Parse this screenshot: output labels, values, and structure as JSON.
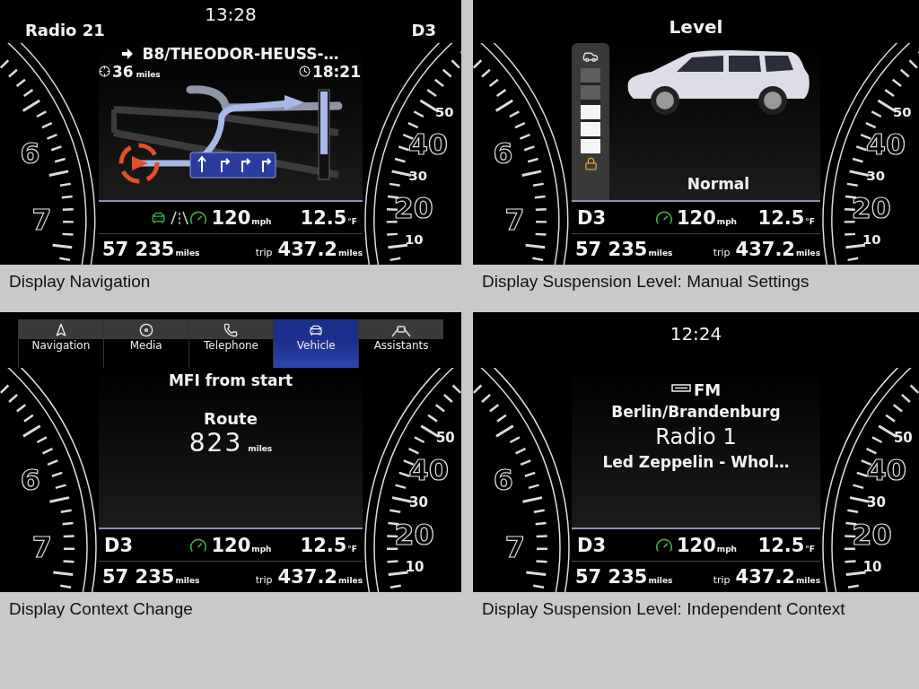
{
  "panels": [
    {
      "kind": "navigation",
      "caption": "Display Navigation",
      "header": {
        "left": "Radio 21",
        "time": "13:28",
        "right": "D3"
      },
      "route": {
        "street": "B8/THEODOR-HEUSS-…",
        "distance": "36",
        "distance_unit": "miles",
        "arrival": "18:21"
      },
      "status": {
        "lane_assist": true,
        "speed": "120",
        "speed_unit": "mph",
        "temperature": "12.5",
        "temperature_unit": "°F"
      },
      "odometer": {
        "total": "57 235",
        "total_unit": "miles",
        "trip_label": "trip",
        "trip": "437.2",
        "trip_unit": "miles"
      },
      "tach_labels": [
        "6",
        "7"
      ],
      "speed_labels": [
        "50",
        "40",
        "30",
        "20",
        "10"
      ]
    },
    {
      "kind": "suspension",
      "caption": "Display Suspension Level: Manual Settings",
      "title": "Level",
      "mode": "Normal",
      "level": 0.6,
      "status": {
        "gear": "D3",
        "speed": "120",
        "speed_unit": "mph",
        "temperature": "12.5",
        "temperature_unit": "°F"
      },
      "odometer": {
        "total": "57 235",
        "total_unit": "miles",
        "trip_label": "trip",
        "trip": "437.2",
        "trip_unit": "miles"
      },
      "tach_labels": [
        "6",
        "7"
      ],
      "speed_labels": [
        "50",
        "40",
        "30",
        "20",
        "10"
      ]
    },
    {
      "kind": "menu",
      "caption": "Display Context Change",
      "tabs": [
        {
          "label": "Navigation",
          "selected": false
        },
        {
          "label": "Media",
          "selected": false
        },
        {
          "label": "Telephone",
          "selected": false
        },
        {
          "label": "Vehicle",
          "selected": true
        },
        {
          "label": "Assistants",
          "selected": false
        }
      ],
      "title": "MFI from start",
      "label": "Route",
      "value": "823",
      "unit": "miles",
      "status": {
        "gear": "D3",
        "speed": "120",
        "speed_unit": "mph",
        "temperature": "12.5",
        "temperature_unit": "°F"
      },
      "odometer": {
        "total": "57 235",
        "total_unit": "miles",
        "trip_label": "trip",
        "trip": "437.2",
        "trip_unit": "miles"
      },
      "tach_labels": [
        "6",
        "7"
      ],
      "speed_labels": [
        "50",
        "40",
        "30",
        "20",
        "10"
      ]
    },
    {
      "kind": "radio",
      "caption": "Display Suspension Level: Independent Context",
      "header": {
        "time": "12:24"
      },
      "source": "FM",
      "region": "Berlin/Brandenburg",
      "station": "Radio 1",
      "track": "Led Zeppelin - Whol…",
      "status": {
        "gear": "D3",
        "speed": "120",
        "speed_unit": "mph",
        "temperature": "12.5",
        "temperature_unit": "°F"
      },
      "odometer": {
        "total": "57 235",
        "total_unit": "miles",
        "trip_label": "trip",
        "trip": "437.2",
        "trip_unit": "miles"
      },
      "tach_labels": [
        "6",
        "7"
      ],
      "speed_labels": [
        "50",
        "40",
        "30",
        "20",
        "10"
      ]
    }
  ]
}
